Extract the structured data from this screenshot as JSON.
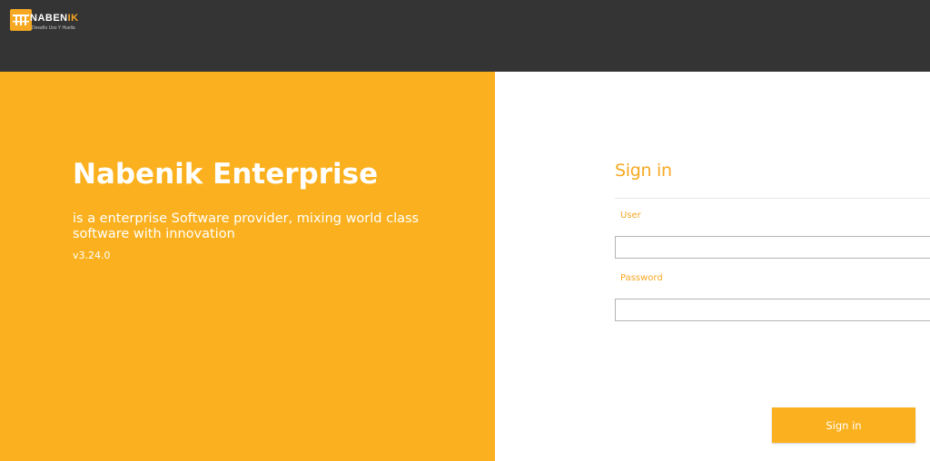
{
  "header": {
    "logo_text_main": "NABEN",
    "logo_text_highlight": "IK",
    "logo_tagline": "Desafío Uso Y Huella",
    "logo_icon": "bridge-icon",
    "background": "#343434"
  },
  "hero": {
    "title": "Nabenik Enterprise",
    "description": "is a enterprise Software provider, mixing world class software with innovation",
    "version": "v3.24.0",
    "background": "#fbb11f"
  },
  "login": {
    "title": "Sign in",
    "user_label": "User",
    "user_value": "",
    "password_label": "Password",
    "password_value": "",
    "submit_label": "Sign in",
    "accent_color": "#f7a823"
  }
}
